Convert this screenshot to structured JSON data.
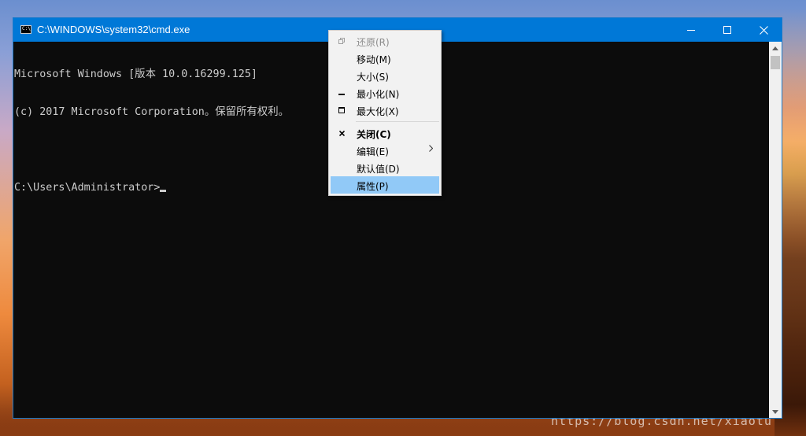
{
  "window": {
    "title": "C:\\WINDOWS\\system32\\cmd.exe",
    "icon": "cmd-app-icon",
    "icon_text": "C:\\"
  },
  "console": {
    "lines": [
      "Microsoft Windows [版本 10.0.16299.125]",
      "(c) 2017 Microsoft Corporation。保留所有权利。",
      "",
      "C:\\Users\\Administrator>"
    ]
  },
  "context_menu": {
    "items": [
      {
        "label": "还原(R)",
        "icon": "restore-icon",
        "disabled": true
      },
      {
        "label": "移动(M)"
      },
      {
        "label": "大小(S)"
      },
      {
        "label": "最小化(N)",
        "icon": "minimize-icon"
      },
      {
        "label": "最大化(X)",
        "icon": "maximize-icon"
      },
      {
        "label": "关闭(C)",
        "icon": "close-icon",
        "bold": true
      },
      {
        "label": "编辑(E)",
        "submenu": true
      },
      {
        "label": "默认值(D)"
      },
      {
        "label": "属性(P)",
        "highlighted": true
      }
    ]
  },
  "desktop": {
    "watermark": "https://blog.csdn.net/xiaotu"
  },
  "colors": {
    "titlebar": "#0078d7",
    "console_bg": "#0c0c0c",
    "console_fg": "#cccccc",
    "menu_bg": "#f2f2f2",
    "menu_highlight": "#91c9f7"
  }
}
